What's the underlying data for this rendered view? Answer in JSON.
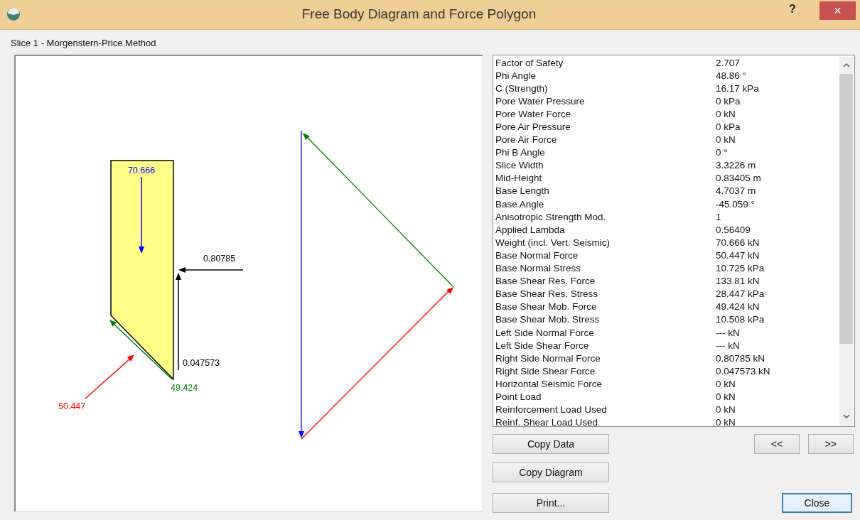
{
  "window": {
    "title": "Free Body Diagram and Force Polygon",
    "help": "?",
    "close": "×"
  },
  "subtitle": "Slice  1 - Morgenstern-Price  Method",
  "forces": [
    {
      "kind": "weight",
      "label": "70.666",
      "color": "#0000ff"
    },
    {
      "kind": "base_normal",
      "label": "50.447",
      "color": "#ff0000"
    },
    {
      "kind": "base_shear",
      "label": "49.424",
      "color": "#008000"
    },
    {
      "kind": "right_normal",
      "label": "0.80785",
      "color": "#000000"
    },
    {
      "kind": "right_shear",
      "label": "0.047573",
      "color": "#000000"
    }
  ],
  "properties": [
    {
      "name": "Factor of Safety",
      "value": "2.707"
    },
    {
      "name": "Phi Angle",
      "value": "48.86 °"
    },
    {
      "name": "C (Strength)",
      "value": "16.17 kPa"
    },
    {
      "name": "Pore Water Pressure",
      "value": "0 kPa"
    },
    {
      "name": "Pore Water Force",
      "value": "0 kN"
    },
    {
      "name": "Pore Air Pressure",
      "value": "0 kPa"
    },
    {
      "name": "Pore Air Force",
      "value": "0 kN"
    },
    {
      "name": "Phi B Angle",
      "value": "0 °"
    },
    {
      "name": "Slice Width",
      "value": "3.3226 m"
    },
    {
      "name": "Mid-Height",
      "value": "0.83405 m"
    },
    {
      "name": "Base Length",
      "value": "4.7037 m"
    },
    {
      "name": "Base Angle",
      "value": "-45.059 °"
    },
    {
      "name": "Anisotropic Strength Mod.",
      "value": "1"
    },
    {
      "name": "Applied Lambda",
      "value": "0.56409"
    },
    {
      "name": "Weight (incl. Vert. Seismic)",
      "value": "70.666 kN"
    },
    {
      "name": "Base Normal Force",
      "value": "50.447 kN"
    },
    {
      "name": "Base Normal Stress",
      "value": "10.725 kPa"
    },
    {
      "name": "Base Shear Res. Force",
      "value": "133.81 kN"
    },
    {
      "name": "Base Shear Res. Stress",
      "value": "28.447 kPa"
    },
    {
      "name": "Base Shear Mob. Force",
      "value": "49.424 kN"
    },
    {
      "name": "Base Shear Mob. Stress",
      "value": "10.508 kPa"
    },
    {
      "name": "Left Side Normal Force",
      "value": "--- kN"
    },
    {
      "name": "Left Side Shear Force",
      "value": "--- kN"
    },
    {
      "name": "Right Side Normal Force",
      "value": "0.80785 kN"
    },
    {
      "name": "Right Side Shear Force",
      "value": "0.047573 kN"
    },
    {
      "name": "Horizontal Seismic Force",
      "value": "0 kN"
    },
    {
      "name": "Point Load",
      "value": "0 kN"
    },
    {
      "name": "Reinforcement Load Used",
      "value": "0 kN"
    },
    {
      "name": "Reinf. Shear Load Used",
      "value": "0 kN"
    }
  ],
  "buttons": {
    "copy_data": "Copy Data",
    "copy_diagram": "Copy Diagram",
    "print": "Print...",
    "previous": "<<",
    "next": ">>",
    "close": "Close"
  }
}
